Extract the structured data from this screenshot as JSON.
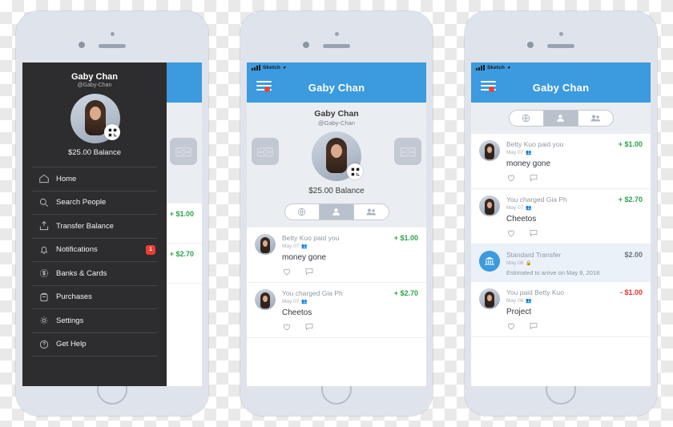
{
  "status_bar": {
    "carrier": "Sketch",
    "wifi_icon": "wifi-icon"
  },
  "nav": {
    "title": "Gaby Chan",
    "menu_icon": "hamburger-icon",
    "badge_dot": "notification-dot"
  },
  "colors": {
    "accent_blue": "#3c9ade",
    "positive_green": "#2aa14a",
    "negative_red": "#e8312a",
    "drawer_dark": "#2d2d2f",
    "badge_red": "#ef3b30"
  },
  "profile": {
    "name": "Gaby Chan",
    "handle": "@Gaby-Chan",
    "balance": "$25.00 Balance",
    "qr_icon": "qr-code-icon",
    "pay_icon": "money-pay-icon",
    "request_icon": "money-request-icon"
  },
  "segmented": {
    "options": [
      {
        "icon": "globe-icon",
        "label": "Public",
        "selected": false
      },
      {
        "icon": "person-icon",
        "label": "Friends",
        "selected": true
      },
      {
        "icon": "people-icon",
        "label": "Groups",
        "selected": false
      }
    ]
  },
  "feed": {
    "items": [
      {
        "avatar": "avatar-betty",
        "title": "Betty Kuo paid you",
        "date": "May 07",
        "privacy_icon": "friends-privacy-icon",
        "amount": "+ $1.00",
        "amount_kind": "positive",
        "note": "money gone",
        "like_icon": "heart-icon",
        "comment_icon": "comment-icon"
      },
      {
        "avatar": "avatar-gia",
        "title": "You charged Gia Ph",
        "date": "May 07",
        "privacy_icon": "friends-privacy-icon",
        "amount": "+ $2.70",
        "amount_kind": "positive",
        "note": "Cheetos",
        "like_icon": "heart-icon",
        "comment_icon": "comment-icon"
      },
      {
        "avatar": "bank-icon",
        "title": "Standard Transfer",
        "date": "May 06",
        "privacy_icon": "lock-icon",
        "amount": "$2.00",
        "amount_kind": "neutral",
        "note": "",
        "estimate": "Estimated to arrive on May 8, 2018",
        "is_transfer": true
      },
      {
        "avatar": "avatar-betty2",
        "title": "You paid Betty Kuo",
        "date": "May 06",
        "privacy_icon": "friends-privacy-icon",
        "amount": "- $1.00",
        "amount_kind": "negative",
        "note": "Project",
        "like_icon": "heart-icon",
        "comment_icon": "comment-icon"
      }
    ]
  },
  "drawer": {
    "name": "Gaby Chan",
    "handle": "@Gaby-Chan",
    "balance": "$25.00 Balance",
    "items": [
      {
        "icon": "home-icon",
        "label": "Home",
        "badge": ""
      },
      {
        "icon": "search-icon",
        "label": "Search People",
        "badge": ""
      },
      {
        "icon": "transfer-icon",
        "label": "Transfer Balance",
        "badge": ""
      },
      {
        "icon": "bell-icon",
        "label": "Notifications",
        "badge": "1"
      },
      {
        "icon": "dollar-circle-icon",
        "label": "Banks & Cards",
        "badge": ""
      },
      {
        "icon": "purchases-icon",
        "label": "Purchases",
        "badge": ""
      },
      {
        "icon": "gear-icon",
        "label": "Settings",
        "badge": ""
      },
      {
        "icon": "help-icon",
        "label": "Get Help",
        "badge": ""
      }
    ]
  }
}
